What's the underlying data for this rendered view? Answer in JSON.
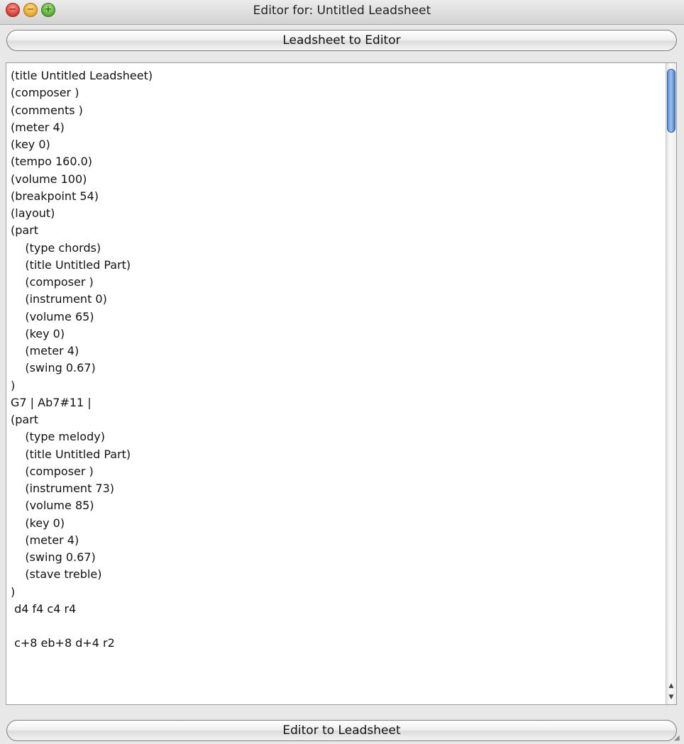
{
  "window": {
    "title": "Editor for: Untitled Leadsheet"
  },
  "buttons": {
    "leadsheet_to_editor": "Leadsheet to Editor",
    "editor_to_leadsheet": "Editor to Leadsheet"
  },
  "editor": {
    "content": "(title Untitled Leadsheet)\n(composer )\n(comments )\n(meter 4)\n(key 0)\n(tempo 160.0)\n(volume 100)\n(breakpoint 54)\n(layout)\n(part\n    (type chords)\n    (title Untitled Part)\n    (composer )\n    (instrument 0)\n    (volume 65)\n    (key 0)\n    (meter 4)\n    (swing 0.67)\n)\nG7 | Ab7#11 |\n(part\n    (type melody)\n    (title Untitled Part)\n    (composer )\n    (instrument 73)\n    (volume 85)\n    (key 0)\n    (meter 4)\n    (swing 0.67)\n    (stave treble)\n)\n d4 f4 c4 r4\n\n c+8 eb+8 d+4 r2"
  },
  "icons": {
    "close": "close-icon",
    "minimize": "minimize-icon",
    "maximize": "zoom-icon",
    "scroll_up": "scroll-up-arrow-icon",
    "scroll_down": "scroll-down-arrow-icon",
    "resize": "resize-grip-icon"
  },
  "colors": {
    "scroll_thumb": "#6a9be0",
    "close": "#d9362b",
    "minimize": "#e8a321",
    "maximize": "#4fa82e"
  }
}
